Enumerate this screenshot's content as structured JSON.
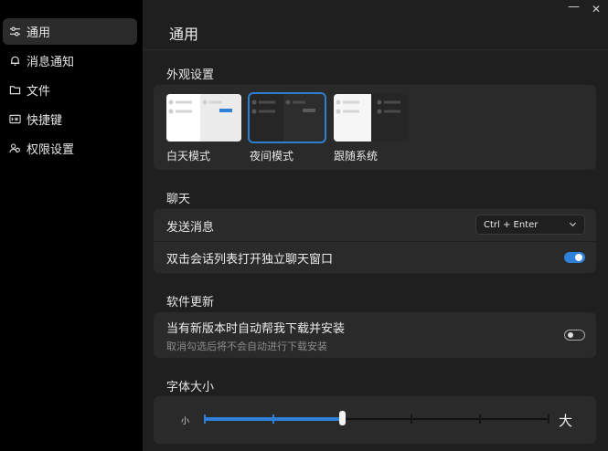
{
  "sidebar": {
    "items": [
      {
        "label": "通用",
        "icon": "sliders-icon",
        "active": true
      },
      {
        "label": "消息通知",
        "icon": "bell-icon",
        "active": false
      },
      {
        "label": "文件",
        "icon": "folder-icon",
        "active": false
      },
      {
        "label": "快捷键",
        "icon": "keyboard-icon",
        "active": false
      },
      {
        "label": "权限设置",
        "icon": "people-icon",
        "active": false
      }
    ]
  },
  "window": {
    "minimize": "—",
    "close": "✕"
  },
  "page": {
    "title": "通用"
  },
  "appearance": {
    "section_title": "外观设置",
    "themes": [
      {
        "label": "白天模式",
        "selected": false
      },
      {
        "label": "夜间模式",
        "selected": true
      },
      {
        "label": "跟随系统",
        "selected": false
      }
    ]
  },
  "chat": {
    "section_title": "聊天",
    "send_message_label": "发送消息",
    "send_shortcut_value": "Ctrl + Enter",
    "double_click_label": "双击会话列表打开独立聊天窗口",
    "double_click_enabled": true
  },
  "update": {
    "section_title": "软件更新",
    "auto_label": "当有新版本时自动帮我下载并安装",
    "auto_sublabel": "取消勾选后将不会自动进行下载安装",
    "auto_enabled": false
  },
  "font_size": {
    "section_title": "字体大小",
    "min_label": "小",
    "max_label": "大",
    "steps": 6,
    "current_step": 2
  },
  "colors": {
    "accent": "#2f80d8",
    "panel": "#2a2a2a",
    "background": "#1f1f1f"
  }
}
